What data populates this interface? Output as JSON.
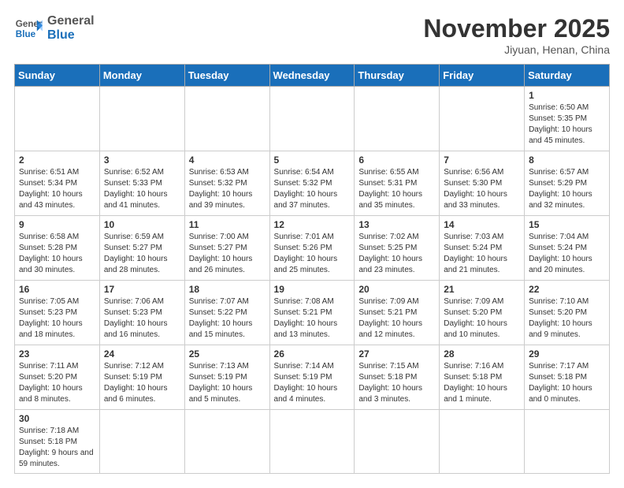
{
  "header": {
    "logo_general": "General",
    "logo_blue": "Blue",
    "month": "November 2025",
    "location": "Jiyuan, Henan, China"
  },
  "weekdays": [
    "Sunday",
    "Monday",
    "Tuesday",
    "Wednesday",
    "Thursday",
    "Friday",
    "Saturday"
  ],
  "days": {
    "1": {
      "sunrise": "6:50 AM",
      "sunset": "5:35 PM",
      "daylight": "10 hours and 45 minutes."
    },
    "2": {
      "sunrise": "6:51 AM",
      "sunset": "5:34 PM",
      "daylight": "10 hours and 43 minutes."
    },
    "3": {
      "sunrise": "6:52 AM",
      "sunset": "5:33 PM",
      "daylight": "10 hours and 41 minutes."
    },
    "4": {
      "sunrise": "6:53 AM",
      "sunset": "5:32 PM",
      "daylight": "10 hours and 39 minutes."
    },
    "5": {
      "sunrise": "6:54 AM",
      "sunset": "5:32 PM",
      "daylight": "10 hours and 37 minutes."
    },
    "6": {
      "sunrise": "6:55 AM",
      "sunset": "5:31 PM",
      "daylight": "10 hours and 35 minutes."
    },
    "7": {
      "sunrise": "6:56 AM",
      "sunset": "5:30 PM",
      "daylight": "10 hours and 33 minutes."
    },
    "8": {
      "sunrise": "6:57 AM",
      "sunset": "5:29 PM",
      "daylight": "10 hours and 32 minutes."
    },
    "9": {
      "sunrise": "6:58 AM",
      "sunset": "5:28 PM",
      "daylight": "10 hours and 30 minutes."
    },
    "10": {
      "sunrise": "6:59 AM",
      "sunset": "5:27 PM",
      "daylight": "10 hours and 28 minutes."
    },
    "11": {
      "sunrise": "7:00 AM",
      "sunset": "5:27 PM",
      "daylight": "10 hours and 26 minutes."
    },
    "12": {
      "sunrise": "7:01 AM",
      "sunset": "5:26 PM",
      "daylight": "10 hours and 25 minutes."
    },
    "13": {
      "sunrise": "7:02 AM",
      "sunset": "5:25 PM",
      "daylight": "10 hours and 23 minutes."
    },
    "14": {
      "sunrise": "7:03 AM",
      "sunset": "5:24 PM",
      "daylight": "10 hours and 21 minutes."
    },
    "15": {
      "sunrise": "7:04 AM",
      "sunset": "5:24 PM",
      "daylight": "10 hours and 20 minutes."
    },
    "16": {
      "sunrise": "7:05 AM",
      "sunset": "5:23 PM",
      "daylight": "10 hours and 18 minutes."
    },
    "17": {
      "sunrise": "7:06 AM",
      "sunset": "5:23 PM",
      "daylight": "10 hours and 16 minutes."
    },
    "18": {
      "sunrise": "7:07 AM",
      "sunset": "5:22 PM",
      "daylight": "10 hours and 15 minutes."
    },
    "19": {
      "sunrise": "7:08 AM",
      "sunset": "5:21 PM",
      "daylight": "10 hours and 13 minutes."
    },
    "20": {
      "sunrise": "7:09 AM",
      "sunset": "5:21 PM",
      "daylight": "10 hours and 12 minutes."
    },
    "21": {
      "sunrise": "7:09 AM",
      "sunset": "5:20 PM",
      "daylight": "10 hours and 10 minutes."
    },
    "22": {
      "sunrise": "7:10 AM",
      "sunset": "5:20 PM",
      "daylight": "10 hours and 9 minutes."
    },
    "23": {
      "sunrise": "7:11 AM",
      "sunset": "5:20 PM",
      "daylight": "10 hours and 8 minutes."
    },
    "24": {
      "sunrise": "7:12 AM",
      "sunset": "5:19 PM",
      "daylight": "10 hours and 6 minutes."
    },
    "25": {
      "sunrise": "7:13 AM",
      "sunset": "5:19 PM",
      "daylight": "10 hours and 5 minutes."
    },
    "26": {
      "sunrise": "7:14 AM",
      "sunset": "5:19 PM",
      "daylight": "10 hours and 4 minutes."
    },
    "27": {
      "sunrise": "7:15 AM",
      "sunset": "5:18 PM",
      "daylight": "10 hours and 3 minutes."
    },
    "28": {
      "sunrise": "7:16 AM",
      "sunset": "5:18 PM",
      "daylight": "10 hours and 1 minute."
    },
    "29": {
      "sunrise": "7:17 AM",
      "sunset": "5:18 PM",
      "daylight": "10 hours and 0 minutes."
    },
    "30": {
      "sunrise": "7:18 AM",
      "sunset": "5:18 PM",
      "daylight": "9 hours and 59 minutes."
    }
  }
}
